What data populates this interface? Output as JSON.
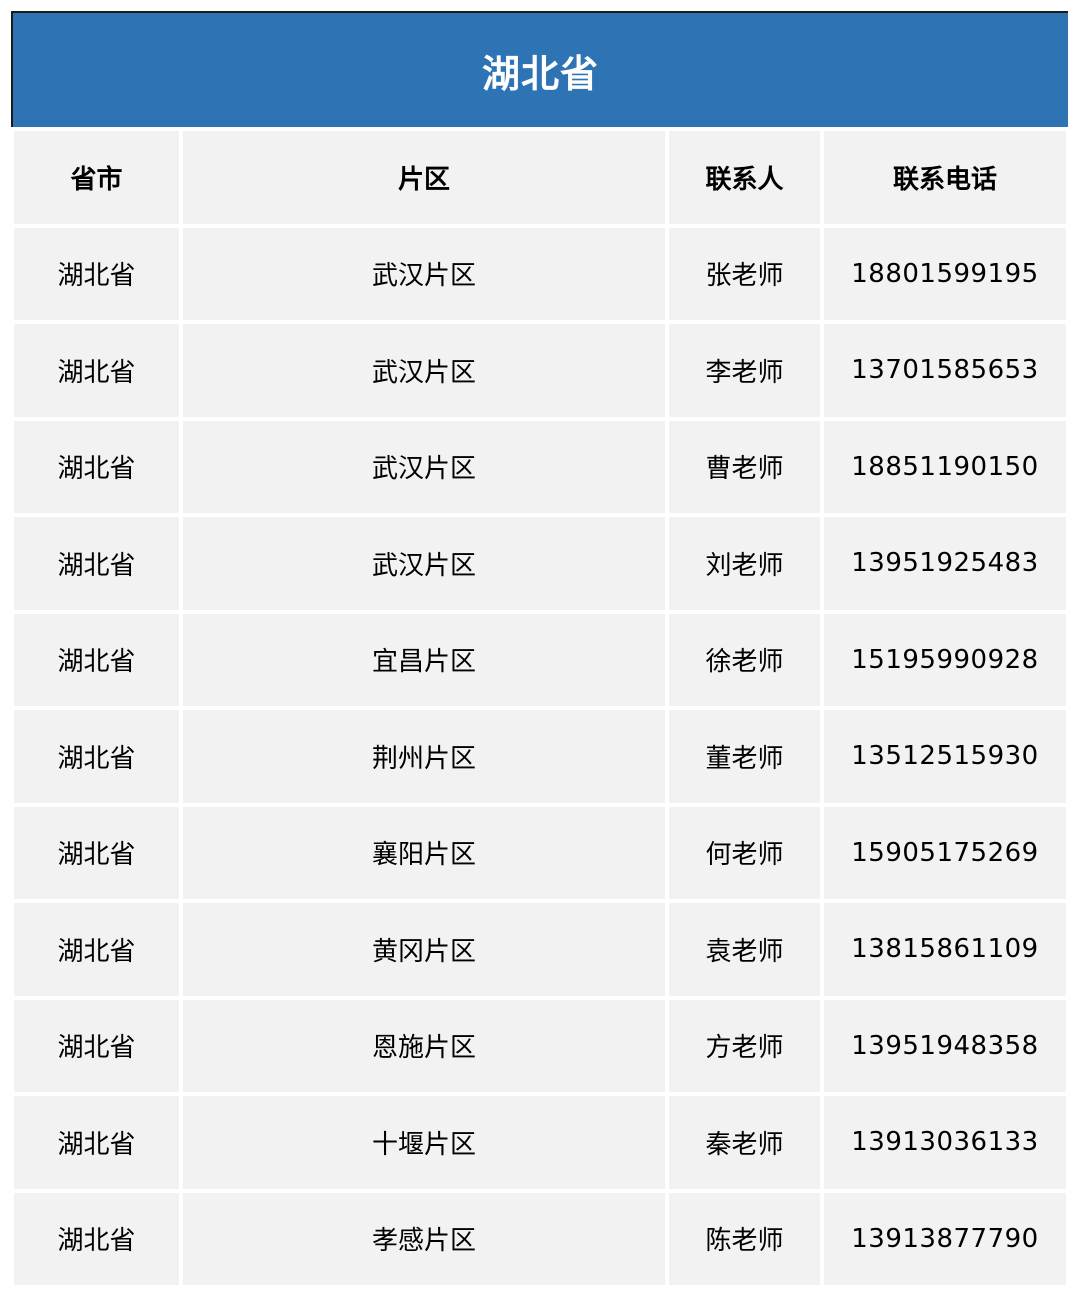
{
  "title": "湖北省",
  "colors": {
    "header_bg": "#2e74b5",
    "cell_bg": "#f2f2f2",
    "title_text": "#ffffff"
  },
  "table": {
    "headers": {
      "province": "省市",
      "area": "片区",
      "contact": "联系人",
      "phone": "联系电话"
    },
    "rows": [
      {
        "province": "湖北省",
        "area": "武汉片区",
        "contact": "张老师",
        "phone": "18801599195"
      },
      {
        "province": "湖北省",
        "area": "武汉片区",
        "contact": "李老师",
        "phone": "13701585653"
      },
      {
        "province": "湖北省",
        "area": "武汉片区",
        "contact": "曹老师",
        "phone": "18851190150"
      },
      {
        "province": "湖北省",
        "area": "武汉片区",
        "contact": "刘老师",
        "phone": "13951925483"
      },
      {
        "province": "湖北省",
        "area": "宜昌片区",
        "contact": "徐老师",
        "phone": "15195990928"
      },
      {
        "province": "湖北省",
        "area": "荆州片区",
        "contact": "董老师",
        "phone": "13512515930"
      },
      {
        "province": "湖北省",
        "area": "襄阳片区",
        "contact": "何老师",
        "phone": "15905175269"
      },
      {
        "province": "湖北省",
        "area": "黄冈片区",
        "contact": "袁老师",
        "phone": "13815861109"
      },
      {
        "province": "湖北省",
        "area": "恩施片区",
        "contact": "方老师",
        "phone": "13951948358"
      },
      {
        "province": "湖北省",
        "area": "十堰片区",
        "contact": "秦老师",
        "phone": "13913036133"
      },
      {
        "province": "湖北省",
        "area": "孝感片区",
        "contact": "陈老师",
        "phone": "13913877790"
      }
    ]
  }
}
